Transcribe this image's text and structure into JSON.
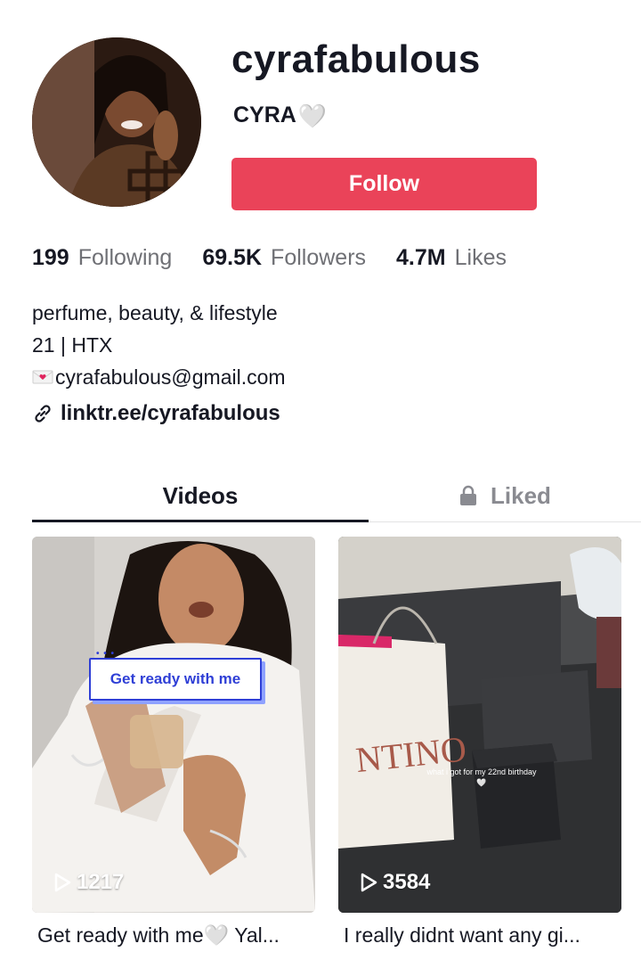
{
  "profile": {
    "username": "cyrafabulous",
    "display_name": "CYRA",
    "display_name_emoji": "🤍",
    "follow_label": "Follow"
  },
  "stats": {
    "following_count": "199",
    "following_label": "Following",
    "followers_count": "69.5K",
    "followers_label": "Followers",
    "likes_count": "4.7M",
    "likes_label": "Likes"
  },
  "bio": {
    "line1": "perfume, beauty, & lifestyle",
    "line2": "21 | HTX",
    "email": "cyrafabulous@gmail.com",
    "link": "linktr.ee/cyrafabulous"
  },
  "tabs": {
    "videos": "Videos",
    "liked": "Liked"
  },
  "videos": [
    {
      "play_count": "1217",
      "sticker_text": "Get ready with me",
      "caption": "Get ready with me🤍 Yal..."
    },
    {
      "play_count": "3584",
      "overlay_text": "what i got for my 22nd birthday🤍",
      "caption": "I really didnt want any gi..."
    }
  ],
  "colors": {
    "accent": "#ea4359",
    "text_primary": "#161823",
    "text_secondary": "#6f7075",
    "sticker_blue": "#2f3fd6"
  },
  "icons": {
    "mail": "envelope-heart-icon",
    "link": "link-icon",
    "lock": "lock-icon",
    "play": "play-icon"
  }
}
